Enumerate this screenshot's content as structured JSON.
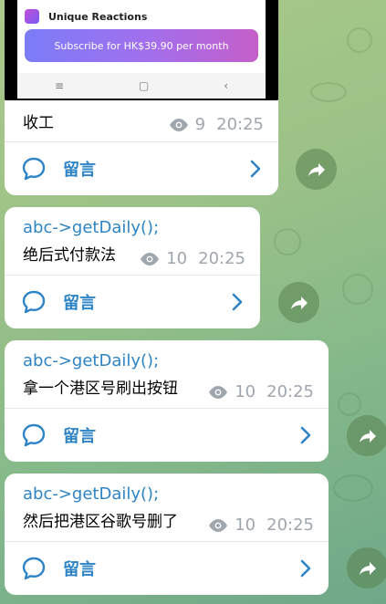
{
  "embedded_screenshot": {
    "app_name": "Unique Reactions",
    "subscribe_label": "Subscribe for HK$39.90 per month",
    "nav_menu_glyph": "≡",
    "nav_home_glyph": "▢",
    "nav_back_glyph": "‹"
  },
  "messages": [
    {
      "sender": "",
      "text": "收工",
      "views": "9",
      "time": "20:25",
      "comment_label": "留言"
    },
    {
      "sender": "abc->getDaily();",
      "text": "绝后式付款法",
      "views": "10",
      "time": "20:25",
      "comment_label": "留言"
    },
    {
      "sender": "abc->getDaily();",
      "text": "拿一个港区号刷出按钮",
      "views": "10",
      "time": "20:25",
      "comment_label": "留言"
    },
    {
      "sender": "abc->getDaily();",
      "text": "然后把港区谷歌号删了",
      "views": "10",
      "time": "20:25",
      "comment_label": "留言"
    }
  ],
  "icons": {
    "views": "eye-icon",
    "comment": "comment-bubble-icon",
    "chevron": "chevron-right-icon",
    "share": "share-arrow-icon"
  },
  "colors": {
    "accent": "#2e84c5",
    "meta_gray": "#a0a6ad",
    "bubble_bg": "#ffffff",
    "wallpaper": "#9cc287"
  }
}
